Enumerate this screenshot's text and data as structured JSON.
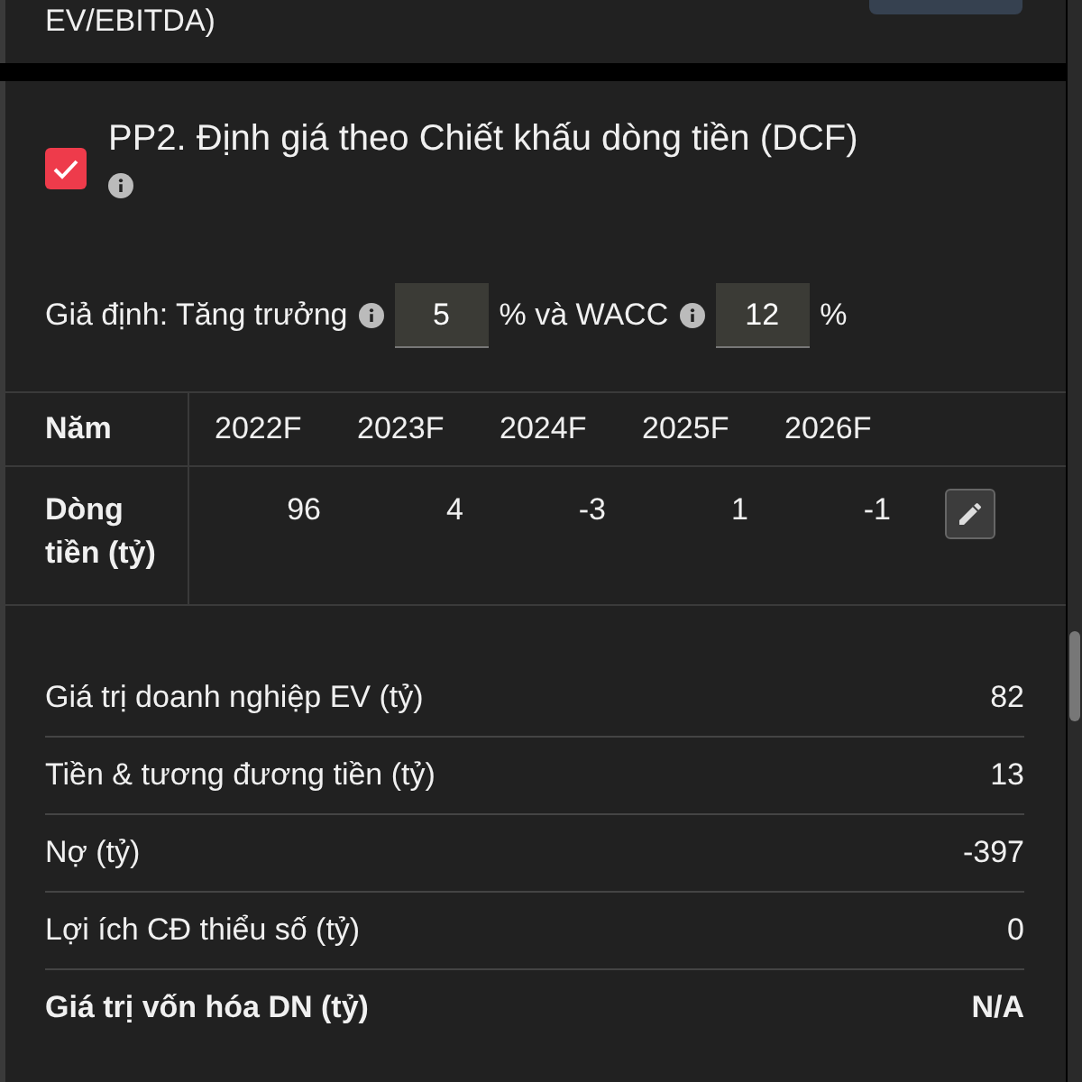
{
  "previous_card": {
    "label_tail": "EV/EBITDA)"
  },
  "method": {
    "checked": true,
    "title": "PP2. Định giá theo Chiết khấu dòng tiền (DCF)"
  },
  "assumptions": {
    "label": "Giả định: Tăng trưởng",
    "growth": "5",
    "between": "% và WACC",
    "wacc": "12",
    "unit": "%"
  },
  "table": {
    "header": "Năm",
    "years": [
      "2022F",
      "2023F",
      "2024F",
      "2025F",
      "2026F"
    ],
    "row_label": "Dòng tiền (tỷ)",
    "values": [
      "96",
      "4",
      "-3",
      "1",
      "-1"
    ]
  },
  "summary": [
    {
      "label": "Giá trị doanh nghiệp EV (tỷ)",
      "value": "82",
      "bold": false
    },
    {
      "label": "Tiền & tương đương tiền (tỷ)",
      "value": "13",
      "bold": false
    },
    {
      "label": "Nợ (tỷ)",
      "value": "-397",
      "bold": false
    },
    {
      "label": "Lợi ích CĐ thiểu số (tỷ)",
      "value": "0",
      "bold": false
    },
    {
      "label": "Giá trị vốn hóa DN (tỷ)",
      "value": "N/A",
      "bold": true
    }
  ]
}
